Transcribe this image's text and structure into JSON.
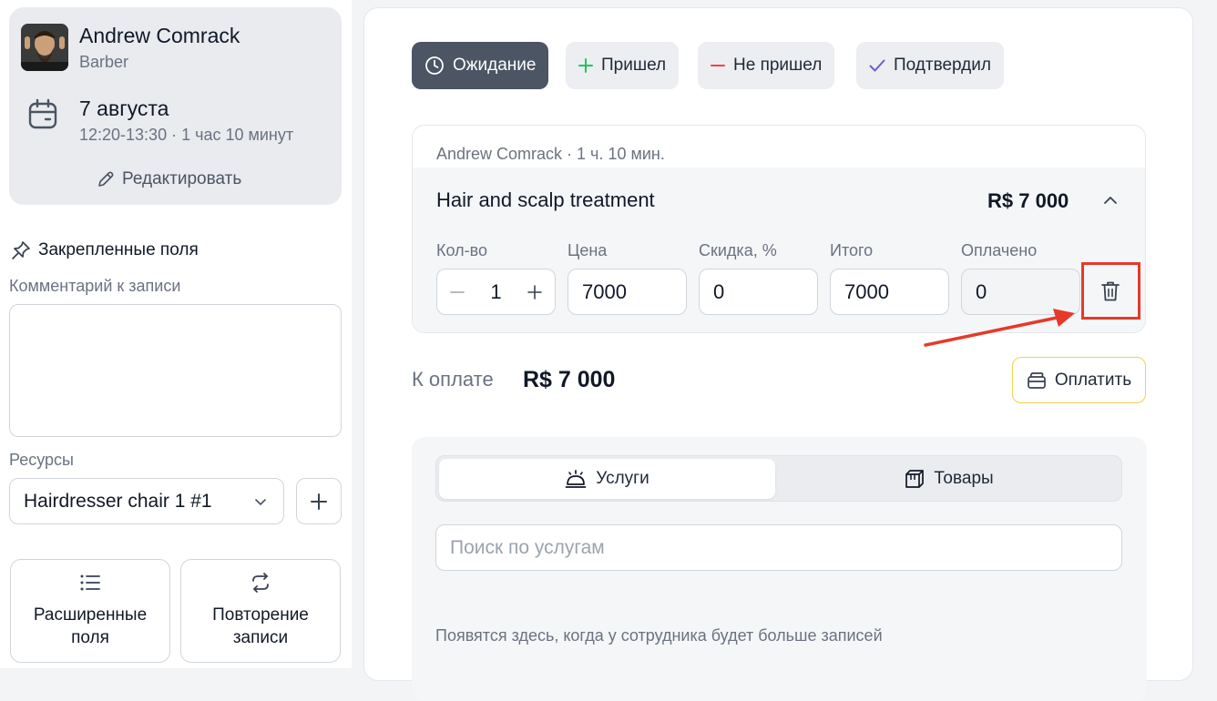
{
  "profile": {
    "name": "Andrew Comrack",
    "role": "Barber",
    "date": "7 августа",
    "time_range": "12:20-13:30 · 1 час 10 минут",
    "edit_label": "Редактировать"
  },
  "sidebar": {
    "pinned_title": "Закрепленные поля",
    "comment_label": "Комментарий к записи",
    "comment_value": "",
    "resources_label": "Ресурсы",
    "resource_selected": "Hairdresser chair 1 #1",
    "tiles": [
      {
        "label": "Расширенные\nполя",
        "icon": "list-icon"
      },
      {
        "label": "Повторение\nзаписи",
        "icon": "repeat-icon"
      }
    ]
  },
  "status": {
    "buttons": [
      {
        "label": "Ожидание",
        "icon": "clock-icon",
        "active": true
      },
      {
        "label": "Пришел",
        "icon": "plus-icon",
        "color": "#22c55e"
      },
      {
        "label": "Не пришел",
        "icon": "minus-icon",
        "color": "#ef4444"
      },
      {
        "label": "Подтвердил",
        "icon": "check-icon",
        "color": "#6d5bd0"
      }
    ]
  },
  "service": {
    "meta": "Andrew Comrack · 1 ч. 10 мин.",
    "title": "Hair and scalp treatment",
    "price": "R$ 7 000",
    "fields": {
      "qty_label": "Кол-во",
      "qty": "1",
      "price_label": "Цена",
      "price": "7000",
      "discount_label": "Скидка, %",
      "discount": "0",
      "total_label": "Итого",
      "total": "7000",
      "paid_label": "Оплачено",
      "paid": "0"
    }
  },
  "payment": {
    "label": "К оплате",
    "amount": "R$ 7 000",
    "button": "Оплатить"
  },
  "catalog": {
    "tabs": [
      {
        "label": "Услуги",
        "icon": "service-bell-icon",
        "active": true
      },
      {
        "label": "Товары",
        "icon": "box-icon"
      }
    ],
    "search_placeholder": "Поиск по услугам",
    "empty_note": "Появятся здесь, когда у сотрудника будет больше записей"
  },
  "colors": {
    "highlight": "#e53a2a",
    "active_status": "#4b5563",
    "pay_border": "#f2d14b"
  }
}
